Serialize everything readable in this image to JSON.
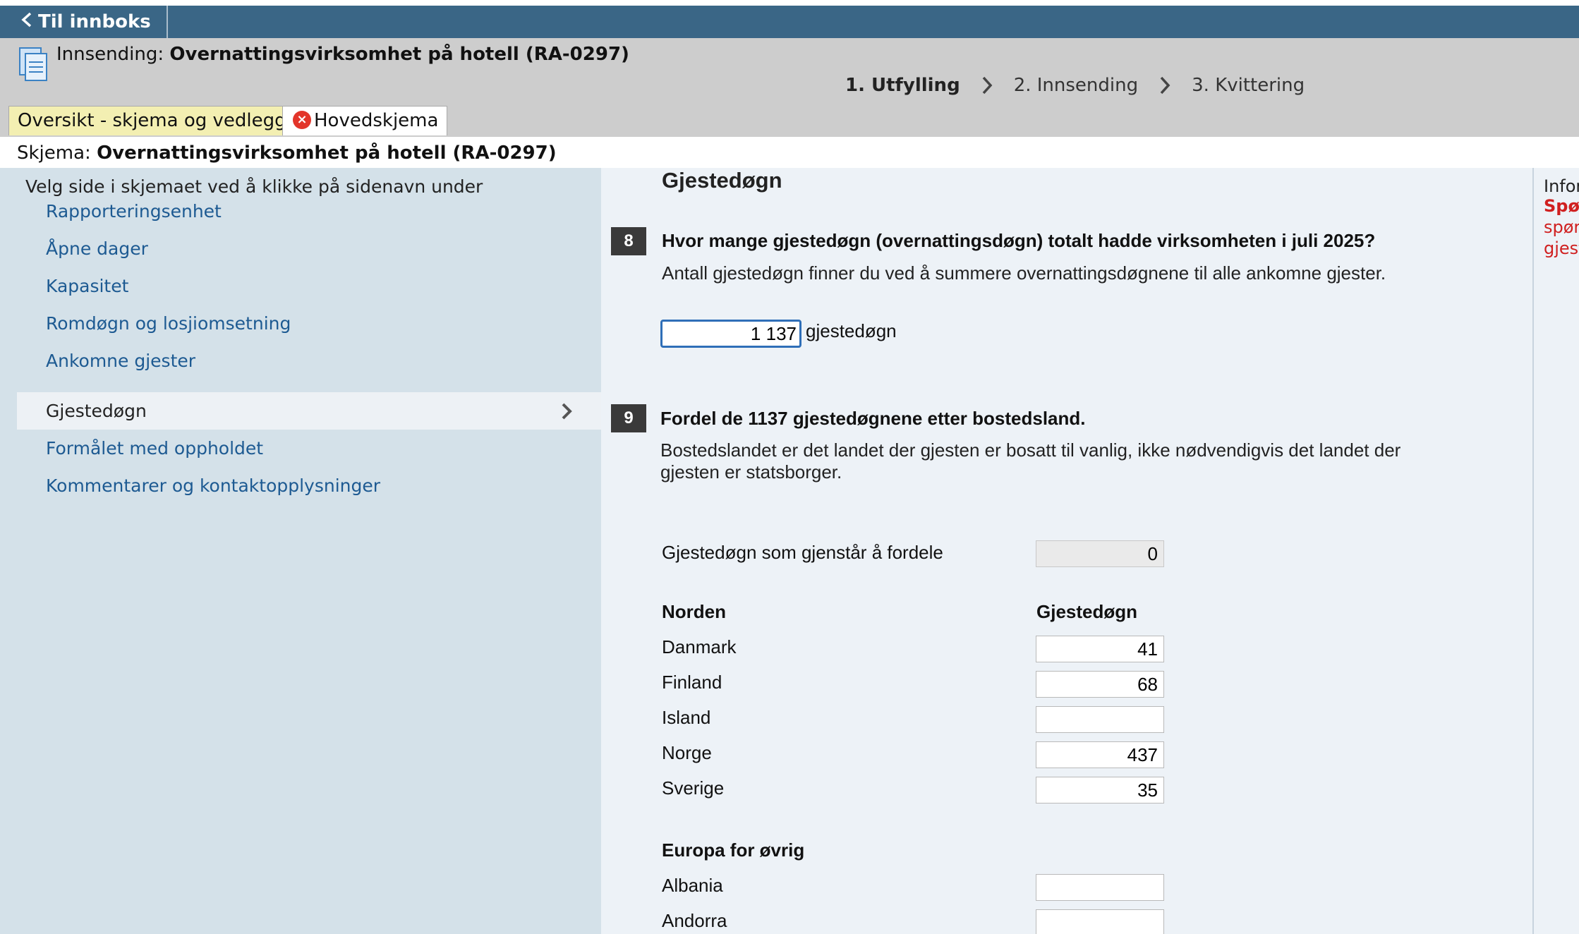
{
  "topbar": {
    "back_label": "Til innboks"
  },
  "header": {
    "submission_prefix": "Innsending: ",
    "submission_title": "Overnattingsvirksomhet på hotell (RA-0297)",
    "steps": [
      "1. Utfylling",
      "2. Innsending",
      "3. Kvittering"
    ],
    "active_step": 0
  },
  "tabs": {
    "overview": "Oversikt - skjema og vedlegg",
    "main": "Hovedskjema"
  },
  "schema": {
    "prefix": "Skjema: ",
    "title": "Overnattingsvirksomhet på hotell (RA-0297)"
  },
  "sidebar": {
    "intro": "Velg side i skjemaet ved å klikke på sidenavn under",
    "items": [
      {
        "label": "Rapporteringsenhet",
        "active": false
      },
      {
        "label": "Åpne dager",
        "active": false
      },
      {
        "label": "Kapasitet",
        "active": false
      },
      {
        "label": "Romdøgn og losjiomsetning",
        "active": false
      },
      {
        "label": "Ankomne gjester",
        "active": false
      },
      {
        "label": "Gjestedøgn",
        "active": true
      },
      {
        "label": "Formålet med oppholdet",
        "active": false
      },
      {
        "label": "Kommentarer og kontaktopplysninger",
        "active": false
      }
    ]
  },
  "main": {
    "section_title": "Gjestedøgn",
    "q8": {
      "number": "8",
      "text": "Hvor mange gjestedøgn (overnattingsdøgn) totalt hadde virksomheten i juli 2025?",
      "help": "Antall gjestedøgn finner du ved å summere overnattingsdøgnene til alle ankomne gjester.",
      "value": "1 137",
      "unit": "gjestedøgn"
    },
    "q9": {
      "number": "9",
      "text": "Fordel de 1137 gjestedøgnene etter bostedsland.",
      "help": "Bostedslandet er det landet der gjesten er bosatt til vanlig, ikke nødvendigvis det landet der gjesten er statsborger.",
      "remaining_label": "Gjestedøgn som gjenstår å fordele",
      "remaining_value": "0",
      "col_header": "Gjestedøgn",
      "groups": [
        {
          "name": "Norden",
          "countries": [
            {
              "name": "Danmark",
              "value": "41"
            },
            {
              "name": "Finland",
              "value": "68"
            },
            {
              "name": "Island",
              "value": ""
            },
            {
              "name": "Norge",
              "value": "437"
            },
            {
              "name": "Sverige",
              "value": "35"
            }
          ]
        },
        {
          "name": "Europa for øvrig",
          "countries": [
            {
              "name": "Albania",
              "value": ""
            },
            {
              "name": "Andorra",
              "value": ""
            }
          ]
        }
      ]
    }
  },
  "info": {
    "title": "Infor",
    "red_bold": "Spø",
    "red_line1": "spør",
    "red_line2": "gjest"
  }
}
